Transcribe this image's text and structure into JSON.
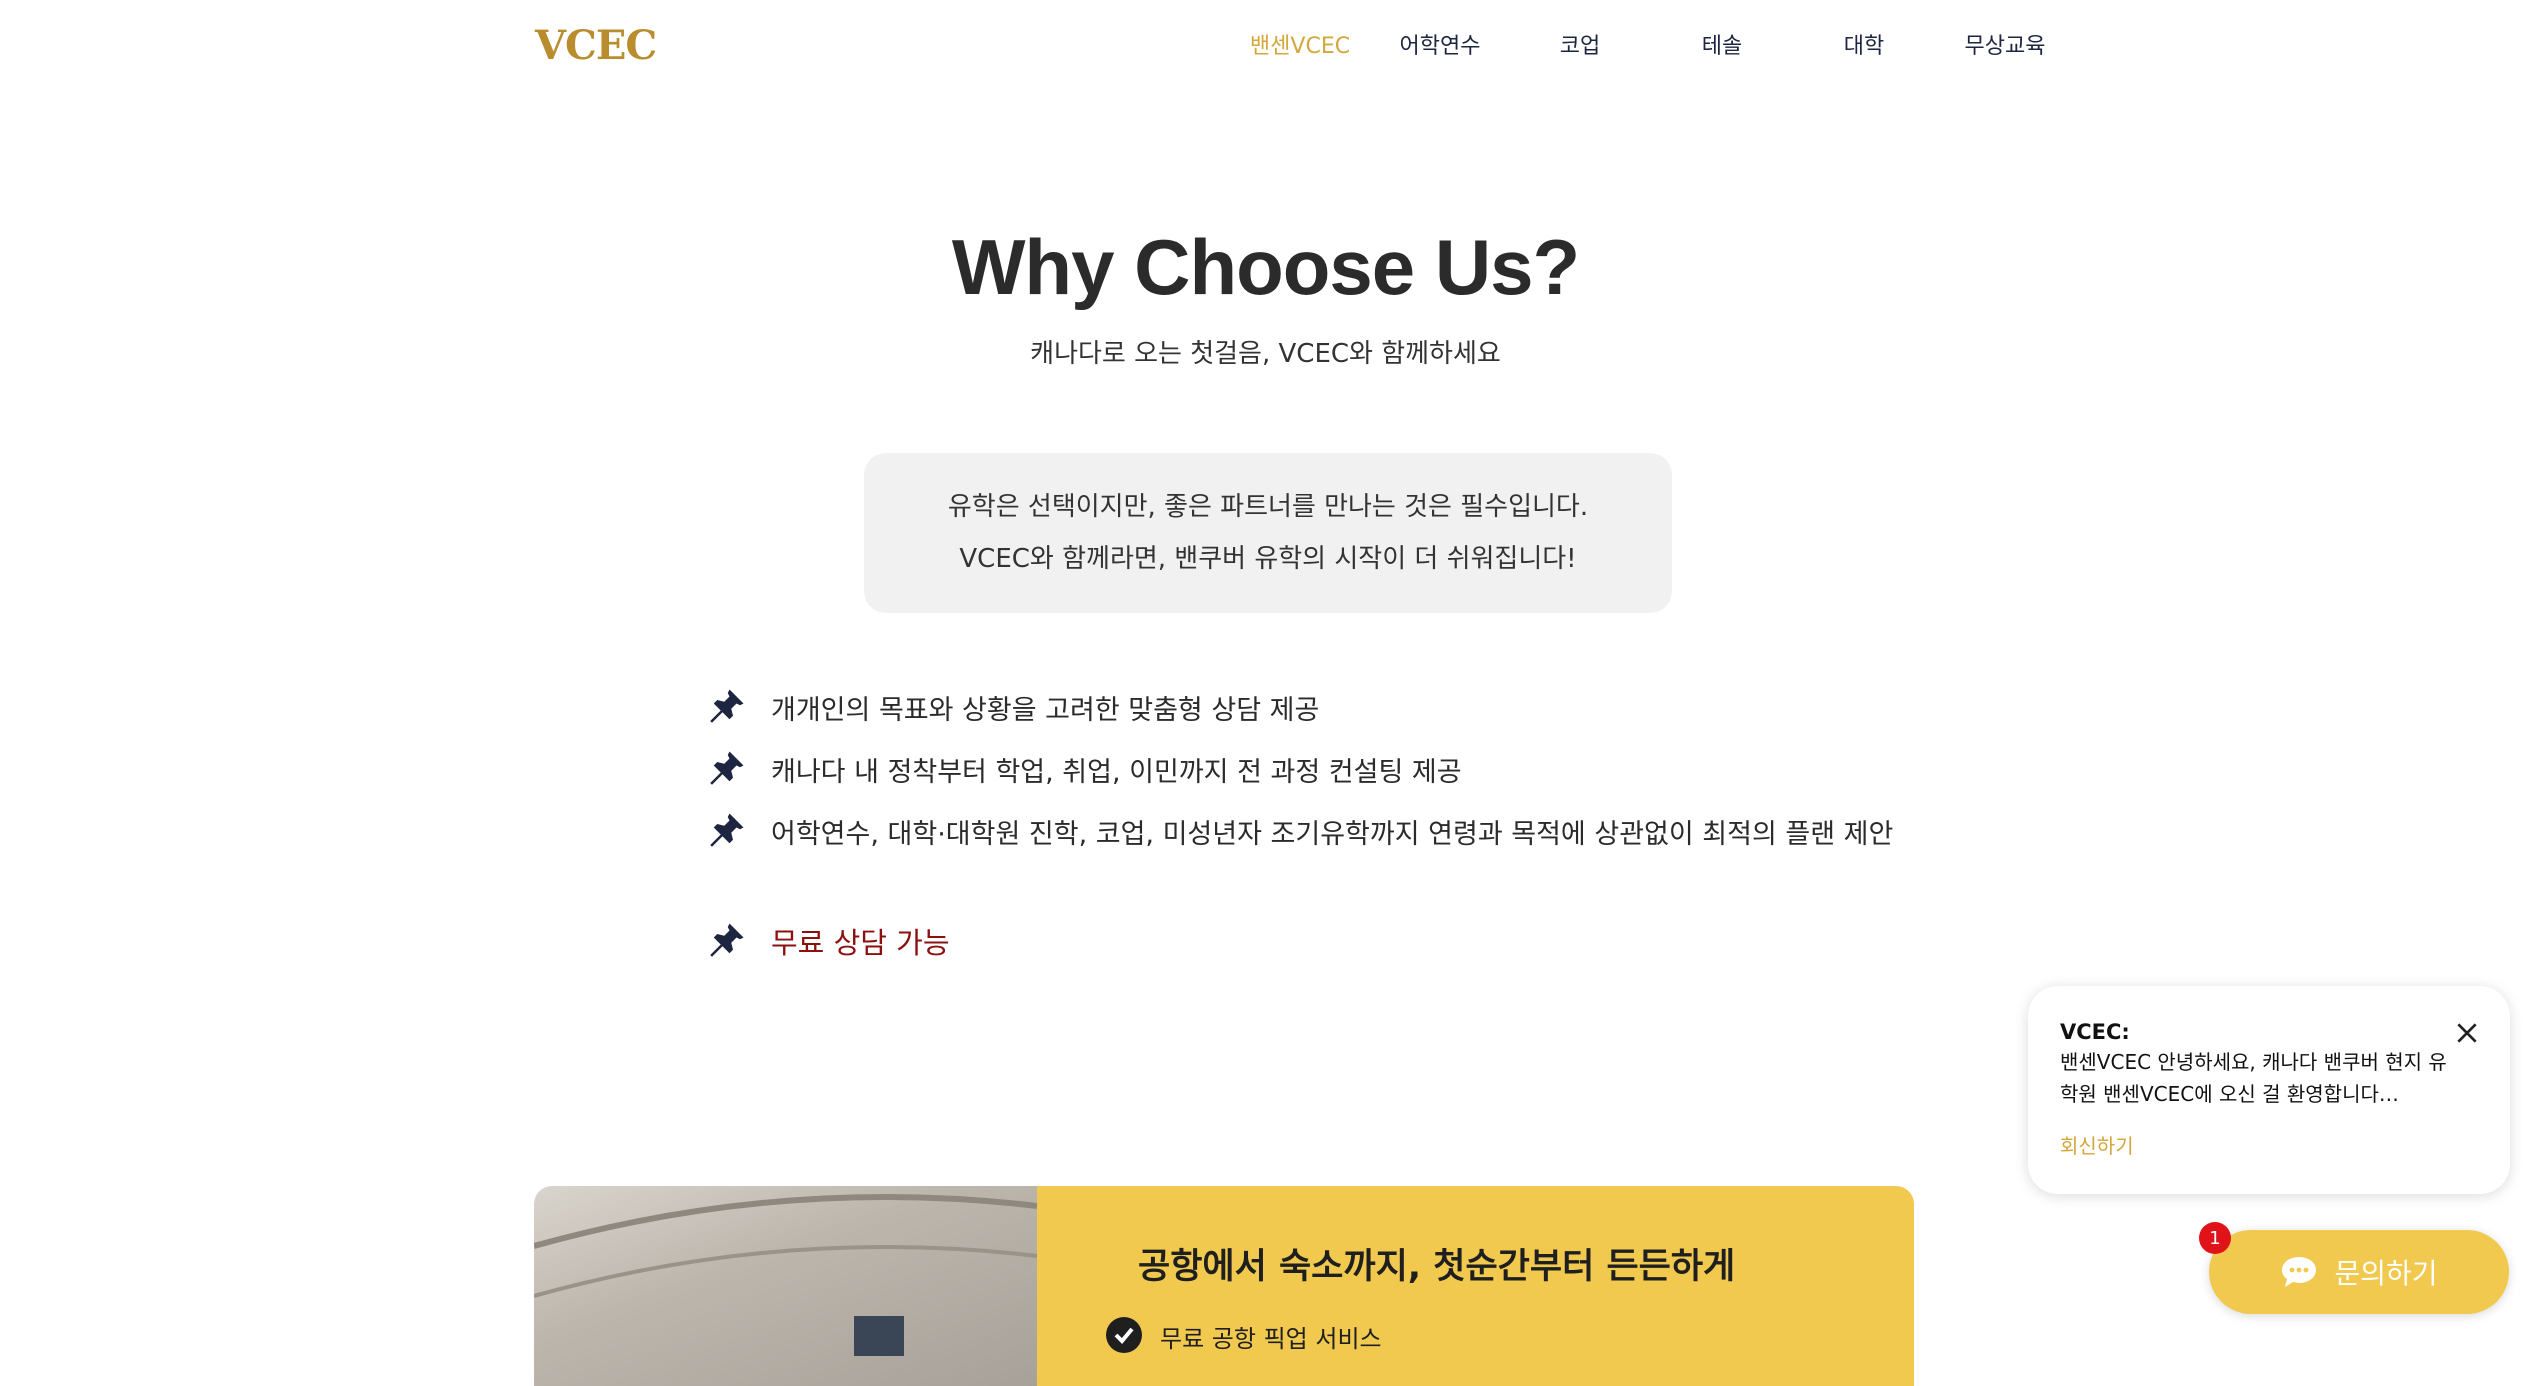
{
  "header": {
    "logo": "VCEC",
    "nav": [
      "밴센VCEC",
      "어학연수",
      "코업",
      "테솔",
      "대학",
      "무상교육"
    ],
    "active_index": 0
  },
  "hero": {
    "title": "Why Choose Us?",
    "subtitle": "캐나다로 오는 첫걸음, VCEC와 함께하세요",
    "quote_line1": "유학은 선택이지만, 좋은 파트너를 만나는 것은 필수입니다.",
    "quote_line2": "VCEC와 함께라면, 밴쿠버 유학의 시작이 더 쉬워집니다!"
  },
  "features": [
    "개개인의 목표와 상황을 고려한 맞춤형 상담 제공",
    "캐나다 내 정착부터 학업, 취업, 이민까지 전 과정 컨설팅 제공",
    "어학연수, 대학·대학원 진학, 코업, 미성년자 조기유학까지 연령과 목적에 상관없이 최적의 플랜 제안",
    "무료 상담 가능"
  ],
  "card": {
    "title": "공항에서 숙소까지, 첫순간부터 든든하게",
    "item": "무료 공항 픽업 서비스"
  },
  "chat": {
    "sender": "VCEC:",
    "message": "밴센VCEC 안녕하세요, 캐나다 밴쿠버 현지 유학원 밴센VCEC에 오신 걸 환영합니다…",
    "reply": "회신하기",
    "button": "문의하기",
    "badge": "1"
  },
  "colors": {
    "accent": "#d4a73a",
    "yellow": "#f1c94f",
    "highlight": "#8b1010",
    "navy": "#1d2540"
  },
  "icons": {
    "feature_bullet": "pushpin-icon",
    "close": "close-icon",
    "chat": "chat-bubble-icon",
    "check": "check-circle-icon"
  }
}
